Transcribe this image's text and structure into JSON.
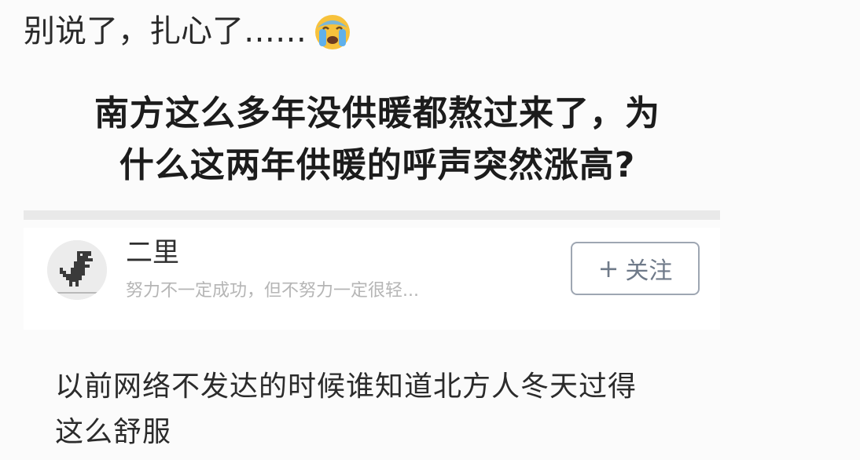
{
  "caption": {
    "text": "别说了，扎心了……",
    "emoji_icon": "crying-face-emoji"
  },
  "question": {
    "line1": "南方这么多年没供暖都熬过来了，为",
    "line2": "什么这两年供暖的呼声突然涨高?"
  },
  "author": {
    "avatar_icon": "dinosaur-icon",
    "name": "二里",
    "bio": "努力不一定成功，但不努力一定很轻...",
    "follow_plus": "+",
    "follow_label": "关注"
  },
  "answer": {
    "line1": "以前网络不发达的时候谁知道北方人冬天过得",
    "line2": "这么舒服"
  },
  "colors": {
    "background": "#fbfbfb",
    "divider": "#e9e9e9",
    "follow_border": "#9ea6b2",
    "follow_text": "#6f7a89",
    "bio_text": "#b5b5b5"
  }
}
